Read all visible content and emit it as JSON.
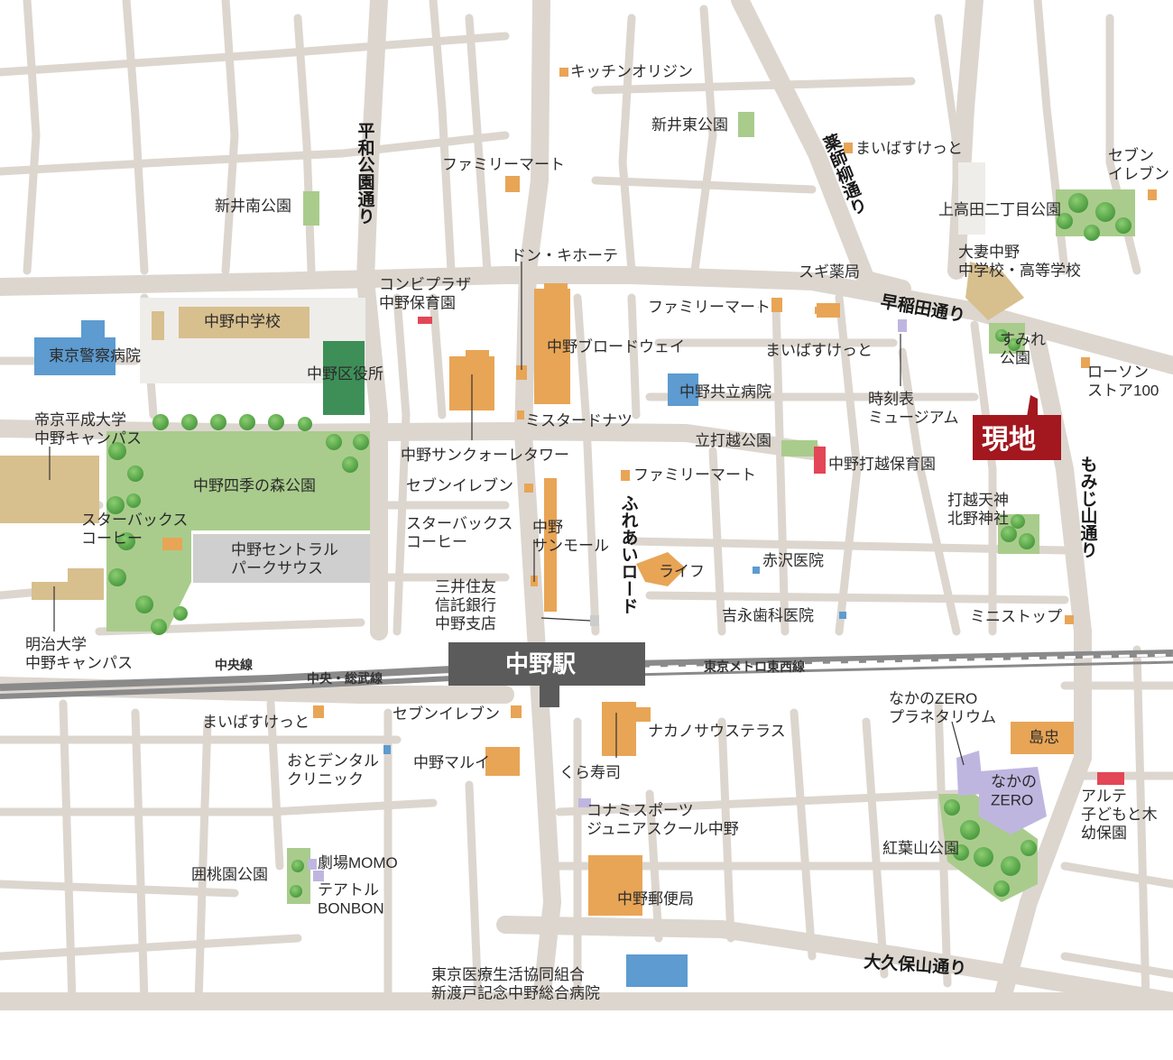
{
  "colors": {
    "road": "#dcd6cf",
    "park": "#a9cc8c",
    "tree": "#55a347",
    "shop": "#e8a556",
    "hospital": "#5d9bd0",
    "public": "#c9ae7a",
    "office": "#3d8f57",
    "culture": "#bfb6e0",
    "nursery": "#e34656",
    "site": "#a3171f",
    "rail": "#8a8a8a",
    "station": "#5b5b5b"
  },
  "site": {
    "label": "現地"
  },
  "station": {
    "label": "中野駅"
  },
  "rails": {
    "chuo": "中央線",
    "chuo_sobu": "中央・総武線",
    "tozai": "東京メトロ東西線"
  },
  "roads": {
    "heiwa_koen": "平和公園通り",
    "yakushi_ayame": "薬師柳通り",
    "waseda": "早稲田通り",
    "momiji_yama": "もみじ山通り",
    "fureai": "ふれあいロード",
    "okubo_yama": "大久保山通り"
  },
  "places": {
    "kitchen_origin": "キッチンオリジン",
    "arai_higashi_park": "新井東公園",
    "maibasuketto_1": "まいばすけっと",
    "seven_eleven_1": "セブン\nイレブン",
    "family_mart_1": "ファミリーマート",
    "arai_minami_park": "新井南公園",
    "kamitakada_park": "上高田二丁目公園",
    "otsuma_nakano": "大妻中野\n中学校・高等学校",
    "don_quijote": "ドン・キホーテ",
    "sugi_yakkyoku": "スギ薬局",
    "conbi_plaza": "コンビプラザ\n中野保育園",
    "family_mart_2": "ファミリーマート",
    "nakano_jhs": "中野中学校",
    "broadway": "中野ブロードウェイ",
    "maibasuketto_2": "まいばすけっと",
    "sumire_park": "すみれ\n公園",
    "tokyo_police_hospital": "東京警察病院",
    "nakano_ward_office": "中野区役所",
    "nakano_kyoritsu_hospital": "中野共立病院",
    "lawson_100": "ローソン\nストア100",
    "clock_museum": "時刻表\nミュージアム",
    "misdo": "ミスタードナツ",
    "teikyo_heisei": "帝京平成大学\n中野キャンパス",
    "tategoshi_park": "立打越公園",
    "sunquare_tower": "中野サンクォーレタワー",
    "tategoshi_nursery": "中野打越保育園",
    "shiki_no_mori_park": "中野四季の森公園",
    "seven_eleven_2": "セブンイレブン",
    "family_mart_3": "ファミリーマート",
    "uchikoshi_shrine": "打越天神\n北野神社",
    "starbucks_1": "スターバックス\nコーヒー",
    "central_park_south": "中野セントラル\nパークサウス",
    "starbucks_2": "スターバックス\nコーヒー",
    "sunmall": "中野\nサンモール",
    "life": "ライフ",
    "akazawa_clinic": "赤沢医院",
    "smbc_trust": "三井住友\n信託銀行\n中野支店",
    "yoshinaga_dental": "吉永歯科医院",
    "ministop": "ミニストップ",
    "meiji_univ": "明治大学\n中野キャンパス",
    "maibasuketto_3": "まいばすけっと",
    "seven_eleven_3": "セブンイレブン",
    "nakano_south_terrace": "ナカノサウステラス",
    "nakano_zero_planetarium": "なかのZERO\nプラネタリウム",
    "shimachu": "島忠",
    "oto_dental": "おとデンタル\nクリニック",
    "nakano_marui": "中野マルイ",
    "kura_sushi": "くら寿司",
    "nakano_zero": "なかの\nZERO",
    "arte_kindergarten": "アルテ\n子どもと木\n幼保園",
    "konami_sports": "コナミスポーツ\nジュニアスクール中野",
    "momijiyama_park": "紅葉山公園",
    "kyoto_momo": "劇場MOMO",
    "kakutoen_park": "囲桃園公園",
    "theatre_bonbon": "テアトル\nBONBON",
    "nakano_post": "中野郵便局",
    "tokyo_coop_hospital": "東京医療生活協同組合\n新渡戸記念中野総合病院"
  }
}
